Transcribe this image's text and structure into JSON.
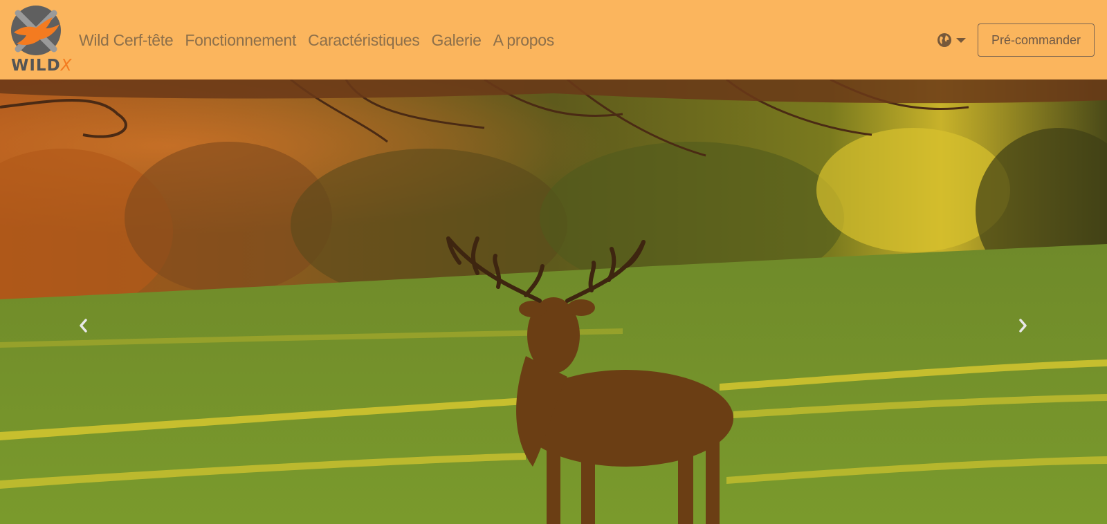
{
  "brand": {
    "logo_text": "WILDX",
    "logo_word_main": "WILD",
    "logo_word_accent": "X",
    "icon": "deer-head-logo-icon"
  },
  "nav": {
    "links": [
      {
        "label": "Wild Cerf-tête"
      },
      {
        "label": "Fonctionnement"
      },
      {
        "label": "Caractéristiques"
      },
      {
        "label": "Galerie"
      },
      {
        "label": "A propos"
      }
    ],
    "language_icon": "globe-icon",
    "language_caret": "caret-down-icon",
    "cta_label": "Pré-commander"
  },
  "carousel": {
    "prev_icon": "chevron-left-icon",
    "next_icon": "chevron-right-icon",
    "slide_image": "red-deer-stag-autumn-meadow"
  },
  "colors": {
    "navbar_bg": "#fbb55d",
    "nav_link": "#8c6f4a",
    "brand_orange": "#f47b20",
    "brand_grey": "#555555"
  }
}
